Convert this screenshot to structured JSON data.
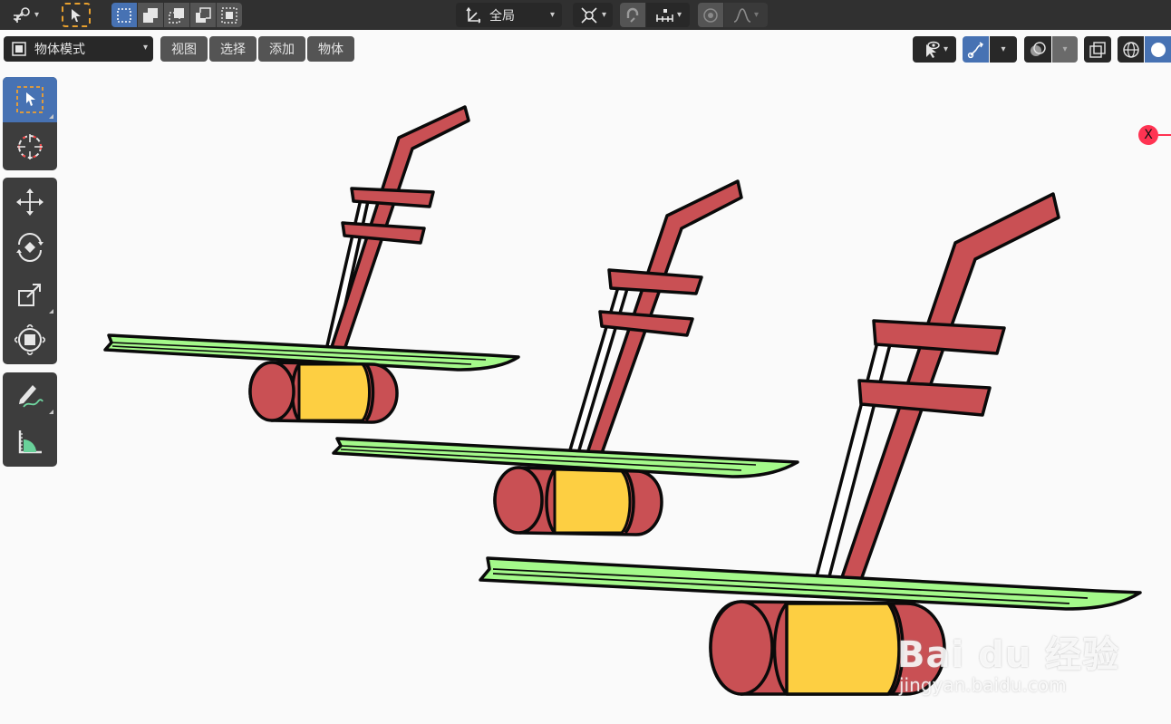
{
  "topbar": {
    "transform_orientation": "全局"
  },
  "header": {
    "mode": "物体模式",
    "menus": [
      "视图",
      "选择",
      "添加",
      "物体"
    ]
  },
  "toolbar": {
    "tools": [
      "select-box",
      "cursor",
      "move",
      "rotate",
      "scale",
      "transform",
      "annotate",
      "measure"
    ],
    "active": "select-box"
  },
  "viewport": {
    "axis_label": "X",
    "watermark_main": "Bai du 经验",
    "watermark_sub": "jingyan.baidu.com"
  },
  "colors": {
    "header_bg": "#303030",
    "widget_dark": "#282828",
    "widget_grey": "#545454",
    "accent_blue": "#4772b3",
    "viewport_bg": "#fafafa",
    "erhu_red": "#c95054",
    "erhu_yellow": "#fdcf42",
    "bow_green": "#a4f98a",
    "x_axis_red": "#ff3352"
  }
}
